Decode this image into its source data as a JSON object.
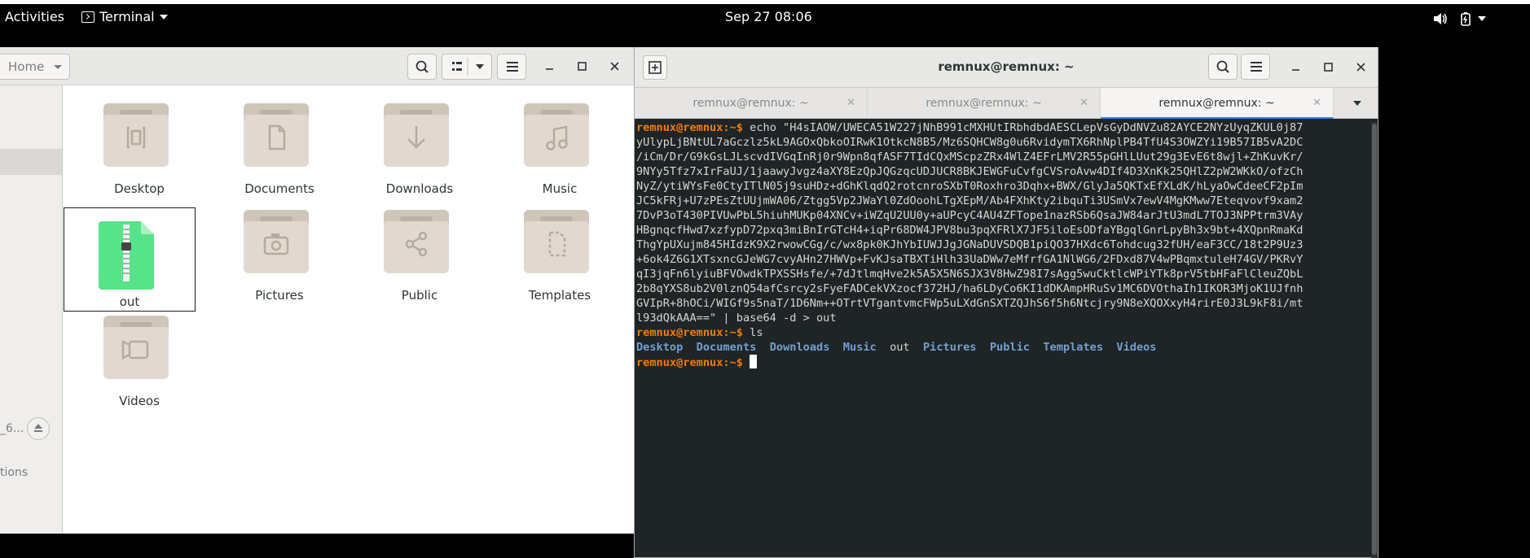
{
  "topbar": {
    "activities": "Activities",
    "app_menu": "Terminal",
    "clock": "Sep 27  08:06"
  },
  "file_manager": {
    "path_label": "Home",
    "sidebar_truncated_1": "_6...",
    "sidebar_truncated_2": "tions",
    "items": [
      {
        "label": "Desktop",
        "icon": "desktop-folder-icon"
      },
      {
        "label": "Documents",
        "icon": "documents-folder-icon"
      },
      {
        "label": "Downloads",
        "icon": "downloads-folder-icon"
      },
      {
        "label": "Music",
        "icon": "music-folder-icon"
      },
      {
        "label": "out",
        "icon": "archive-file-icon",
        "selected": true
      },
      {
        "label": "Pictures",
        "icon": "pictures-folder-icon"
      },
      {
        "label": "Public",
        "icon": "public-folder-icon"
      },
      {
        "label": "Templates",
        "icon": "templates-folder-icon"
      },
      {
        "label": "Videos",
        "icon": "videos-folder-icon"
      }
    ]
  },
  "terminal": {
    "title": "remnux@remnux: ~",
    "tabs": [
      {
        "label": "remnux@remnux: ~"
      },
      {
        "label": "remnux@remnux: ~"
      },
      {
        "label": "remnux@remnux: ~",
        "active": true
      }
    ],
    "prompt": "remnux@remnux:~$",
    "echo_lines": [
      " echo \"H4sIAOW/UWECA51W227jNhB991cMXHUtIRbhdbdAESCLepVsGyDdNVZu82AYCE2NYzUyqZKUL0j87",
      "yUlypLjBNtUL7aGczlz5kL9AGOxQbkoOIRwK1OtkcN8B5/Mz6SQHCW8g0u6RvidymTX6RhNplPB4TfU4S3OWZYi19B57IB5vA2DC",
      "/iCm/Dr/G9kGsLJLscvdIVGqInRj0r9Wpn8qfASF7TIdCQxMScpzZRx4WlZ4EFrLMV2R55pGHlLUut29g3EvE6t8wjl+ZhKuvKr/",
      "9NYy5Tfz7xIrFaUJ/1jaawyJvgz4aXY8EzQpJQGzqcUDJUCR8BKJEWGFuCvfgCVSroAvw4DIf4D3XnKk25QHlZ2pW2WKkO/ofzCh",
      "NyZ/ytiWYsFe0CtyITlN05j9suHDz+dGhKlqdQ2rotcnroSXbT0Roxhro3Dqhx+BWX/GlyJa5QKTxEfXLdK/hLyaOwCdeeCF2pIm",
      "JC5kFRj+U7zPEsZtUUjmWA06/Ztgg5Vp2JWaYl0ZdOoohLTgXEpM/Ab4FXhKty2ibquTi3USmVx7ewV4MgKMww7Eteqvovf9xam2",
      "7DvP3oT430PIVUwPbL5hiuhMUKp04XNCv+iWZqU2UU0y+aUPcyC4AU4ZFTope1nazRSb6QsaJW84arJtU3mdL7TOJ3NPPtrm3VAy",
      "HBgnqcfHwd7xzfypD72pxq3miBnIrGTcH4+iqPr68DW4JPV8bu3pqXFRlX7JF5iloEsODfaYBgqlGnrLpyBh3x9bt+4XQpnRmaKd",
      "ThgYpUXujm845HIdzK9X2rwowCGg/c/wx8pk0KJhYbIUWJJgJGNaDUVSDQB1piQO37HXdc6Tohdcug32fUH/eaF3CC/18t2P9Uz3",
      "+6ok4Z6G1XTsxncGJeWG7cvyAHn27HWVp+FvKJsaTBXTiHlh33UaDWw7eMfrfGA1NlWG6/2FDxd87V4wPBqmxtuleH74GV/PKRvY",
      "qI3jqFn6lyiuBFVOwdkTPXSSHsfe/+7dJtlmqHve2k5A5X5N6SJX3V8HwZ98I7sAgg5wuCktlcWPiYTk8prV5tbHFaFlCleuZQbL",
      "2b8qYXS8ub2V0lznQ54afCsrcy2sFyeFADCekVXzocf372HJ/ha6LDyCo6KI1dDKAmpHRuSv1MC6DVOthaIh1IKOR3MjoK1UJfnh",
      "GVIpR+8hOCi/WIGf9s5naT/1D6Nm++OTrtVTgantvmcFWp5uLXdGnSXTZQJhS6f5h6Ntcjry9N8eXQOXxyH4rirE0J3L9kF8i/mt",
      "l93dQkAAA==\" | base64 -d > out"
    ],
    "ls_cmd": " ls",
    "ls_output": [
      "Desktop",
      "Documents",
      "Downloads",
      "Music",
      "out",
      "Pictures",
      "Public",
      "Templates",
      "Videos"
    ]
  }
}
